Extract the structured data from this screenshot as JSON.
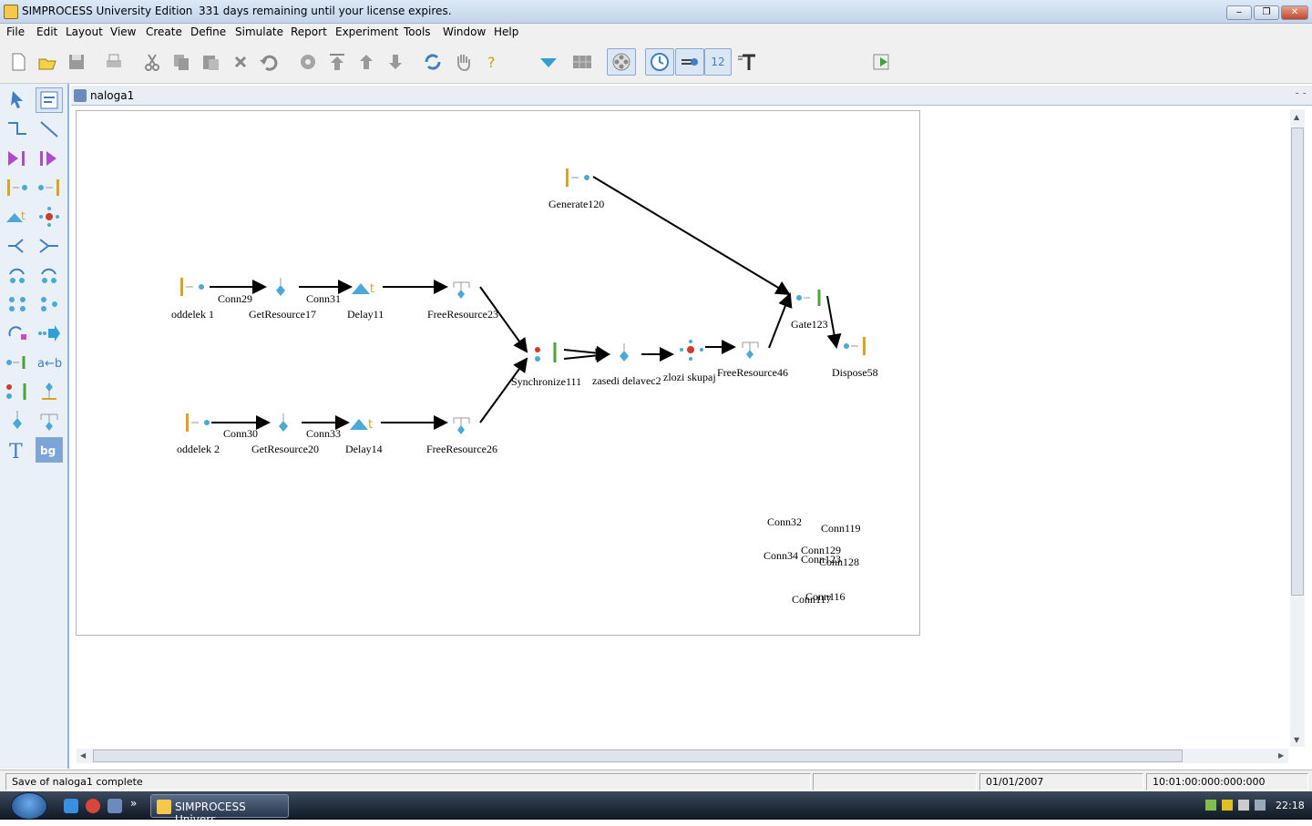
{
  "window": {
    "app_title": "SIMPROCESS University Edition",
    "license_notice": "331 days remaining until your license expires.",
    "controls": {
      "minimize": "‒",
      "maximize": "❐",
      "close": "✕"
    }
  },
  "menu": [
    "File",
    "Edit",
    "Layout",
    "View",
    "Create",
    "Define",
    "Simulate",
    "Report",
    "Experiment",
    "Tools",
    "Window",
    "Help"
  ],
  "toolbar": {
    "icons": [
      "new-icon",
      "open-icon",
      "save-icon",
      "print-icon",
      "cut-icon",
      "copy-icon",
      "paste-icon",
      "delete-icon",
      "undo-icon",
      "properties-icon",
      "move-top-icon",
      "move-up-icon",
      "move-down-icon",
      "refresh-icon",
      "hand-icon",
      "help-icon",
      "dropdown-arrow-icon",
      "grid-icon",
      "film-icon",
      "clock-icon",
      "flow-icon",
      "font-size-icon",
      "text-icon",
      "run-icon"
    ],
    "font_size_value": "12",
    "speed_slider": {
      "min": "1",
      "max": "100",
      "value": 100
    }
  },
  "palette": {
    "items": [
      "pointer-tool-icon",
      "edit-tool-icon",
      "connector-elbow-icon",
      "connector-straight-icon",
      "activity-in-icon",
      "activity-out-icon",
      "generate-icon",
      "dispose-icon",
      "delay-icon",
      "branch-icon",
      "split-icon",
      "join-icon",
      "loop-icon",
      "loop-alt-icon",
      "process-icon",
      "process-alt-icon",
      "transform-icon",
      "forward-icon",
      "gate-icon",
      "assign-icon",
      "synchronize-icon",
      "free-resource-alt-icon",
      "get-resource-icon",
      "free-resource-icon",
      "text-tool-icon",
      "background-tool-icon"
    ]
  },
  "document": {
    "tab_title": "naloga1",
    "tab_controls": "- -"
  },
  "diagram": {
    "node_labels": [
      "Generate120",
      "oddelek 1",
      "GetResource17",
      "Delay11",
      "FreeResource23",
      "Synchronize111",
      "zasedi delavec2",
      "zlozi skupaj",
      "FreeResource46",
      "Gate123",
      "Dispose58",
      "oddelek 2",
      "GetResource20",
      "Delay14",
      "FreeResource26"
    ],
    "connector_labels": [
      "Conn29",
      "Conn31",
      "Conn30",
      "Conn33",
      "Conn32",
      "Conn119",
      "Conn129",
      "Conn34",
      "Conn123",
      "Conn128",
      "Conn117",
      "Conn116"
    ]
  },
  "status": {
    "message": "Save of naloga1 complete",
    "field2": "",
    "date": "01/01/2007",
    "sim_time": "10:01:00:000:000:000"
  },
  "taskbar": {
    "button_label": "SIMPROCESS Univers...",
    "more": "»",
    "time": "22:18"
  },
  "colors": {
    "accent": "#3f7fc1",
    "node_blue": "#4aa9d6",
    "gold": "#d9a520",
    "green": "#4ba33a",
    "red": "#d23a2a"
  }
}
